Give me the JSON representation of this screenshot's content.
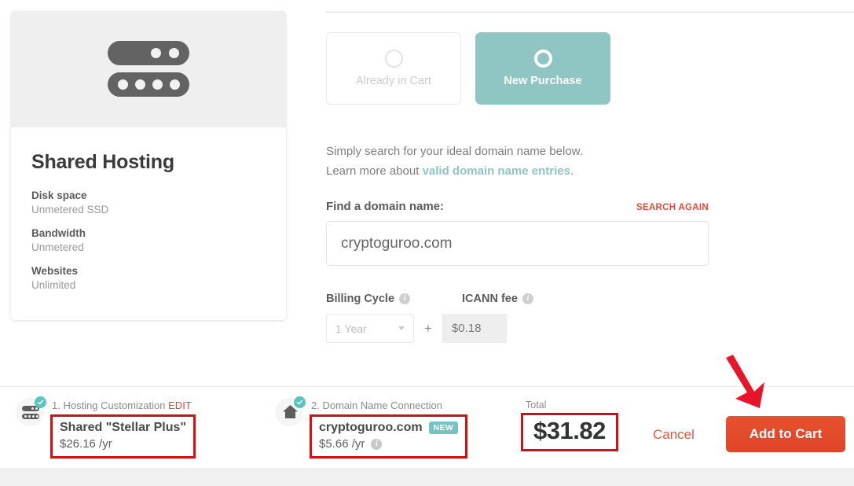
{
  "product_card": {
    "icon": "server-icon",
    "title": "Shared Hosting",
    "specs": [
      {
        "label": "Disk space",
        "value": "Unmetered SSD"
      },
      {
        "label": "Bandwidth",
        "value": "Unmetered"
      },
      {
        "label": "Websites",
        "value": "Unlimited"
      }
    ]
  },
  "purchase_options": [
    {
      "label": "Already in Cart",
      "state": "inactive"
    },
    {
      "label": "New Purchase",
      "state": "active"
    }
  ],
  "intro": {
    "line1": "Simply search for your ideal domain name below.",
    "line2_prefix": "Learn more about ",
    "line2_link": "valid domain name entries",
    "line2_suffix": "."
  },
  "search": {
    "label": "Find a domain name:",
    "again_label": "SEARCH AGAIN",
    "value": "cryptoguroo.com",
    "placeholder": "Find a domain name"
  },
  "billing": {
    "cycle_label": "Billing Cycle",
    "cycle_value": "1 Year",
    "cycle_options": [
      "1 Year"
    ],
    "plus": "+",
    "icann_label": "ICANN fee",
    "icann_value": "$0.18",
    "info_glyph": "i"
  },
  "summary": {
    "hosting": {
      "step": "1. Hosting Customization",
      "edit_label": "EDIT",
      "name": "Shared \"Stellar Plus\"",
      "price": "$26.16 /yr"
    },
    "domain": {
      "step": "2. Domain Name Connection",
      "name": "cryptoguroo.com",
      "badge": "NEW",
      "price": "$5.66 /yr"
    },
    "total_label": "Total",
    "total_value": "$31.82",
    "cancel_label": "Cancel",
    "add_to_cart_label": "Add to Cart"
  },
  "colors": {
    "teal": "#8fc5c2",
    "teal_badge": "#59c4c0",
    "red_accent": "#e04b39",
    "cart_button": "#e8502e",
    "annotation_red": "#d51010"
  }
}
